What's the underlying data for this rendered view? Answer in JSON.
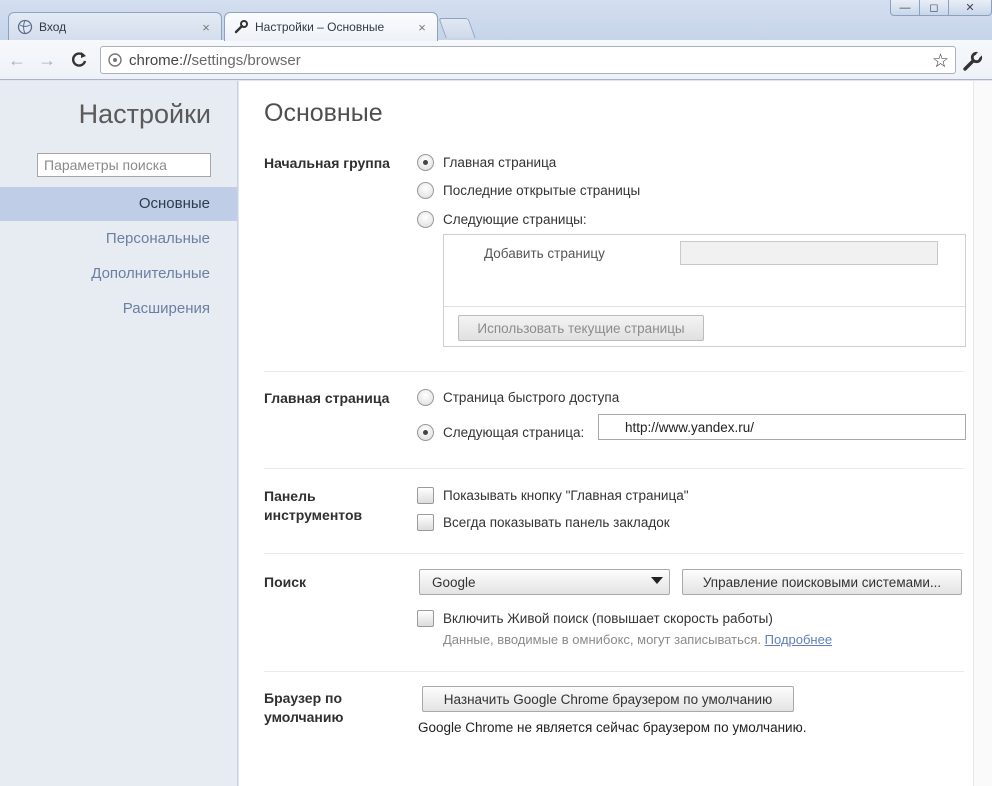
{
  "window": {
    "tabs": [
      {
        "title": "Вход",
        "icon": "globe-icon",
        "close": "×"
      },
      {
        "title": "Настройки – Основные",
        "icon": "wrench-icon",
        "close": "×"
      }
    ],
    "controls": {
      "minimize": "—",
      "maximize": "◻",
      "close": "✕"
    }
  },
  "toolbar": {
    "back": "←",
    "forward": "→",
    "reload": "C",
    "url_scheme": "chrome://",
    "url_path": "settings/browser",
    "star": "☆"
  },
  "sidebar": {
    "title": "Настройки",
    "search_placeholder": "Параметры поиска",
    "items": [
      {
        "label": "Основные",
        "selected": true
      },
      {
        "label": "Персональные",
        "selected": false
      },
      {
        "label": "Дополнительные",
        "selected": false
      },
      {
        "label": "Расширения",
        "selected": false
      }
    ]
  },
  "main": {
    "title": "Основные",
    "startup": {
      "label": "Начальная группа",
      "options": [
        "Главная страница",
        "Последние открытые страницы",
        "Следующие страницы:"
      ],
      "selected": 0,
      "add_page_label": "Добавить страницу",
      "use_current_button": "Использовать текущие страницы"
    },
    "homepage": {
      "label": "Главная страница",
      "options": [
        "Страница быстрого доступа",
        "Следующая страница:"
      ],
      "selected": 1,
      "url": "http://www.yandex.ru/"
    },
    "toolbar_section": {
      "label_line1": "Панель",
      "label_line2": "инструментов",
      "checkboxes": [
        "Показывать кнопку \"Главная страница\"",
        "Всегда показывать панель закладок"
      ]
    },
    "search": {
      "label": "Поиск",
      "engine": "Google",
      "manage_button": "Управление поисковыми системами...",
      "instant_checkbox": "Включить Живой поиск (повышает скорость работы)",
      "hint": "Данные, вводимые в омнибокс, могут записываться.",
      "more_link": "Подробнее"
    },
    "default_browser": {
      "label_line1": "Браузер по",
      "label_line2": "умолчанию",
      "button": "Назначить Google Chrome браузером по умолчанию",
      "status": "Google Chrome не является сейчас браузером по умолчанию."
    }
  },
  "colors": {
    "sidebar_bg": "#e7ecf3",
    "selected_item_bg": "#bfcee6",
    "link": "#6a7fa1"
  }
}
